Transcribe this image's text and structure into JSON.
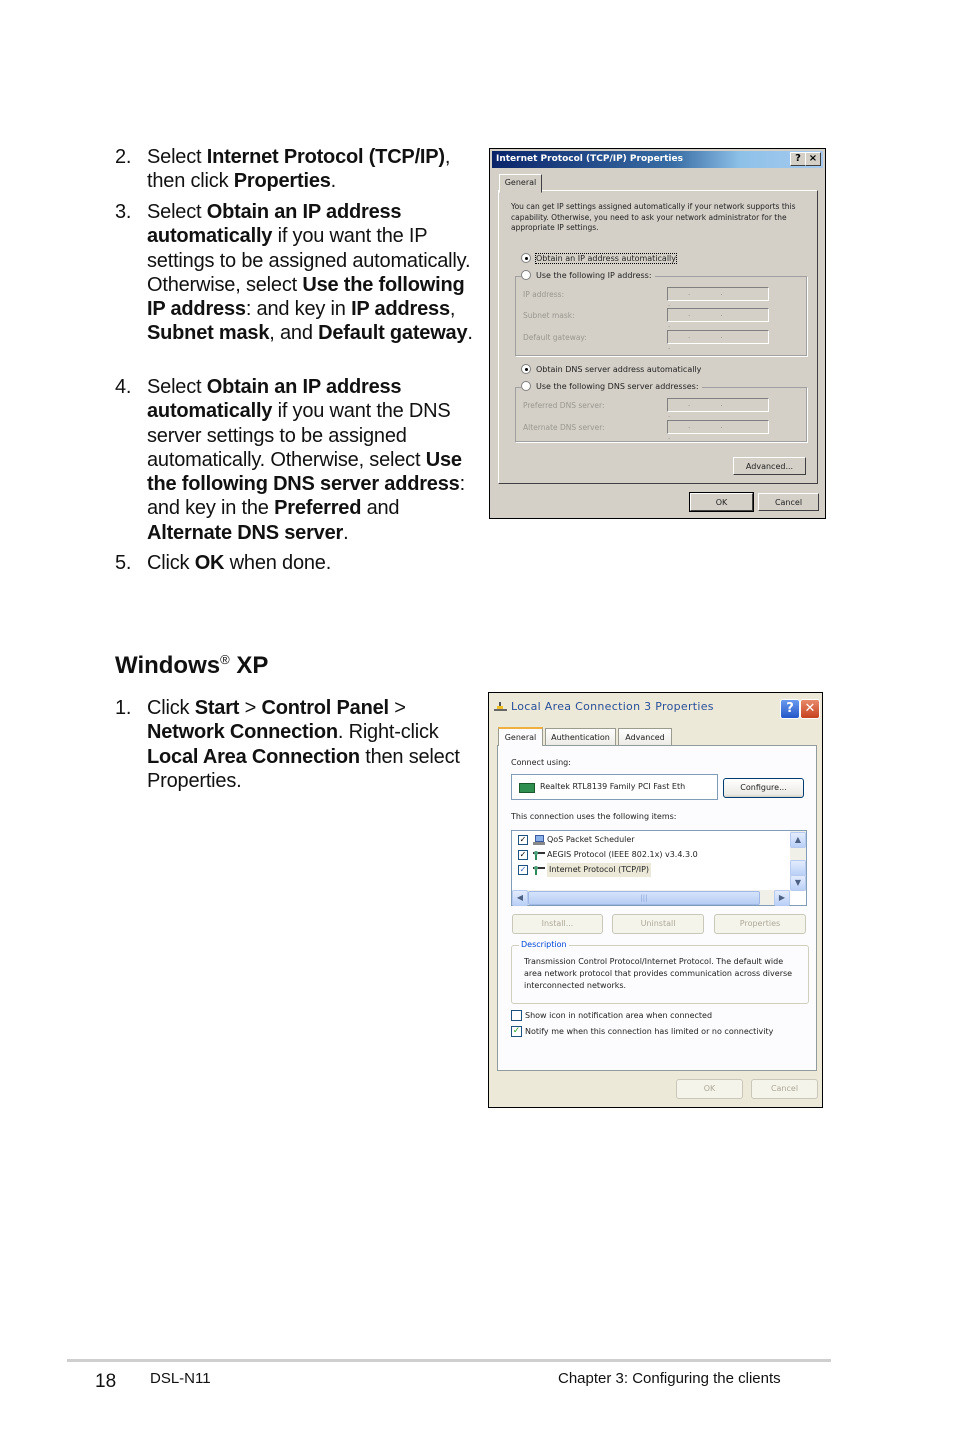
{
  "steps_top": [
    {
      "num": "2.",
      "parts": [
        [
          "t",
          "Select "
        ],
        [
          "b",
          "Internet Protocol (TCP/IP)"
        ],
        [
          "t",
          ", then click "
        ],
        [
          "b",
          "Properties"
        ],
        [
          "t",
          "."
        ]
      ]
    },
    {
      "num": "3.",
      "parts": [
        [
          "t",
          "Select "
        ],
        [
          "b",
          "Obtain an IP address automatically"
        ],
        [
          "t",
          " if you want the IP settings to be assigned automatically. Otherwise, select "
        ],
        [
          "b",
          "Use the following IP address"
        ],
        [
          "t",
          ": and key in "
        ],
        [
          "b",
          "IP address"
        ],
        [
          "t",
          ", "
        ],
        [
          "b",
          "Subnet mask"
        ],
        [
          "t",
          ", and "
        ],
        [
          "b",
          "Default gateway"
        ],
        [
          "t",
          "."
        ]
      ]
    },
    {
      "num": "4.",
      "parts": [
        [
          "t",
          "Select "
        ],
        [
          "b",
          "Obtain an IP address automatically"
        ],
        [
          "t",
          " if you want the DNS server settings to be assigned automatically. Otherwise, select "
        ],
        [
          "b",
          "Use the following DNS server address"
        ],
        [
          "t",
          ": and key in the "
        ],
        [
          "b",
          "Preferred"
        ],
        [
          "t",
          " and "
        ],
        [
          "b",
          "Alternate DNS server"
        ],
        [
          "t",
          "."
        ]
      ]
    },
    {
      "num": "5.",
      "parts": [
        [
          "t",
          "Click "
        ],
        [
          "b",
          "OK"
        ],
        [
          "t",
          " when done."
        ]
      ]
    }
  ],
  "section": {
    "title": "Windows",
    "reg": "®",
    "suffix": " XP"
  },
  "steps_xp": [
    {
      "num": "1.",
      "parts": [
        [
          "t",
          "Click "
        ],
        [
          "b",
          "Start"
        ],
        [
          "t",
          " > "
        ],
        [
          "b",
          "Control Panel"
        ],
        [
          "t",
          " > "
        ],
        [
          "b",
          "Network Connection"
        ],
        [
          "t",
          ". Right-click "
        ],
        [
          "b",
          "Local Area Connection"
        ],
        [
          "t",
          " then select Properties."
        ]
      ]
    }
  ],
  "tcpip_dialog": {
    "title": "Internet Protocol (TCP/IP) Properties",
    "help_btn": "?",
    "close_btn": "×",
    "tab": "General",
    "intro": "You can get IP settings assigned automatically if your network supports this capability. Otherwise, you need to ask your network administrator for the appropriate IP settings.",
    "radio_auto_ip": "Obtain an IP address automatically",
    "radio_manual_ip": "Use the following IP address:",
    "ip_label": "IP address:",
    "subnet_label": "Subnet mask:",
    "gateway_label": "Default gateway:",
    "ip_placeholder": ". . .",
    "radio_auto_dns": "Obtain DNS server address automatically",
    "radio_manual_dns": "Use the following DNS server addresses:",
    "preferred_dns_label": "Preferred DNS server:",
    "alternate_dns_label": "Alternate DNS server:",
    "advanced_btn": "Advanced...",
    "ok_btn": "OK",
    "cancel_btn": "Cancel"
  },
  "lan_dialog": {
    "title": "Local Area Connection 3 Properties",
    "help_btn": "?",
    "close_btn": "✕",
    "tabs": [
      "General",
      "Authentication",
      "Advanced"
    ],
    "connect_using_label": "Connect using:",
    "adapter": "Realtek RTL8139 Family PCI Fast Eth",
    "configure_btn": "Configure...",
    "items_label": "This connection uses the following items:",
    "items": [
      {
        "name": "QoS Packet Scheduler",
        "checked": true,
        "icon": "computer-icon"
      },
      {
        "name": "AEGIS Protocol (IEEE 802.1x) v3.4.3.0",
        "checked": true,
        "icon": "protocol-icon"
      },
      {
        "name": "Internet Protocol (TCP/IP)",
        "checked": true,
        "icon": "protocol-icon",
        "selected": true
      }
    ],
    "install_btn": "Install...",
    "uninstall_btn": "Uninstall",
    "properties_btn": "Properties",
    "description_label": "Description",
    "description": "Transmission Control Protocol/Internet Protocol. The default wide area network protocol that provides communication across diverse interconnected networks.",
    "show_icon_label": "Show icon in notification area when connected",
    "show_icon_checked": false,
    "notify_label": "Notify me when this connection has limited or no connectivity",
    "notify_checked": true,
    "ok_btn": "OK",
    "cancel_btn": "Cancel"
  },
  "footer": {
    "page": "18",
    "model": "DSL-N11",
    "chapter": "Chapter 3: Configuring the clients"
  }
}
